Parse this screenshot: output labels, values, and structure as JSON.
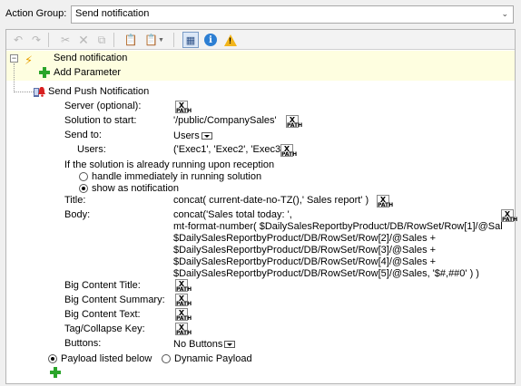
{
  "action_group": {
    "label": "Action Group:",
    "value": "Send notification"
  },
  "colors": {
    "highlight": "#fefee0",
    "accent_green": "#2aa52a",
    "info": "#2d7fd3",
    "warning": "#f2b51b"
  },
  "toolbar": {
    "icons": [
      "undo-icon",
      "redo-icon",
      "cut-icon",
      "delete-icon",
      "copy-icon",
      "paste-icon",
      "paste-special-icon",
      "grid-view-icon",
      "info-icon",
      "warning-icon"
    ]
  },
  "tree": {
    "action_title": "Send notification",
    "add_parameter": "Add Parameter",
    "push_title": "Send Push Notification"
  },
  "fields": {
    "server_label": "Server (optional):",
    "solution_label": "Solution to start:",
    "solution_value": "'/public/CompanySales'",
    "send_to_label": "Send to:",
    "send_to_value": "Users",
    "users_label": "Users:",
    "users_value": "('Exec1', 'Exec2', 'Exec3')",
    "running_label": "If the solution is already running upon reception",
    "opt_handle": "handle immediately in running solution",
    "opt_show": "show as notification",
    "title_label": "Title:",
    "title_value": "concat( current-date-no-TZ(),' Sales report' )",
    "body_label": "Body:",
    "body_lines": [
      "concat('Sales total today: ',",
      "mt-format-number( $DailySalesReportbyProduct/DB/RowSet/Row[1]/@Sal",
      "$DailySalesReportbyProduct/DB/RowSet/Row[2]/@Sales +",
      "$DailySalesReportbyProduct/DB/RowSet/Row[3]/@Sales +",
      "$DailySalesReportbyProduct/DB/RowSet/Row[4]/@Sales +",
      "$DailySalesReportbyProduct/DB/RowSet/Row[5]/@Sales, '$#,##0' ) )"
    ],
    "big_title_label": "Big Content Title:",
    "big_summary_label": "Big Content Summary:",
    "big_text_label": "Big Content Text:",
    "tag_label": "Tag/Collapse Key:",
    "buttons_label": "Buttons:",
    "buttons_value": "No Buttons"
  },
  "payload": {
    "listed_below": "Payload listed below",
    "dynamic": "Dynamic Payload"
  },
  "xpath_badge": {
    "top": "X",
    "bottom": "PATH"
  }
}
